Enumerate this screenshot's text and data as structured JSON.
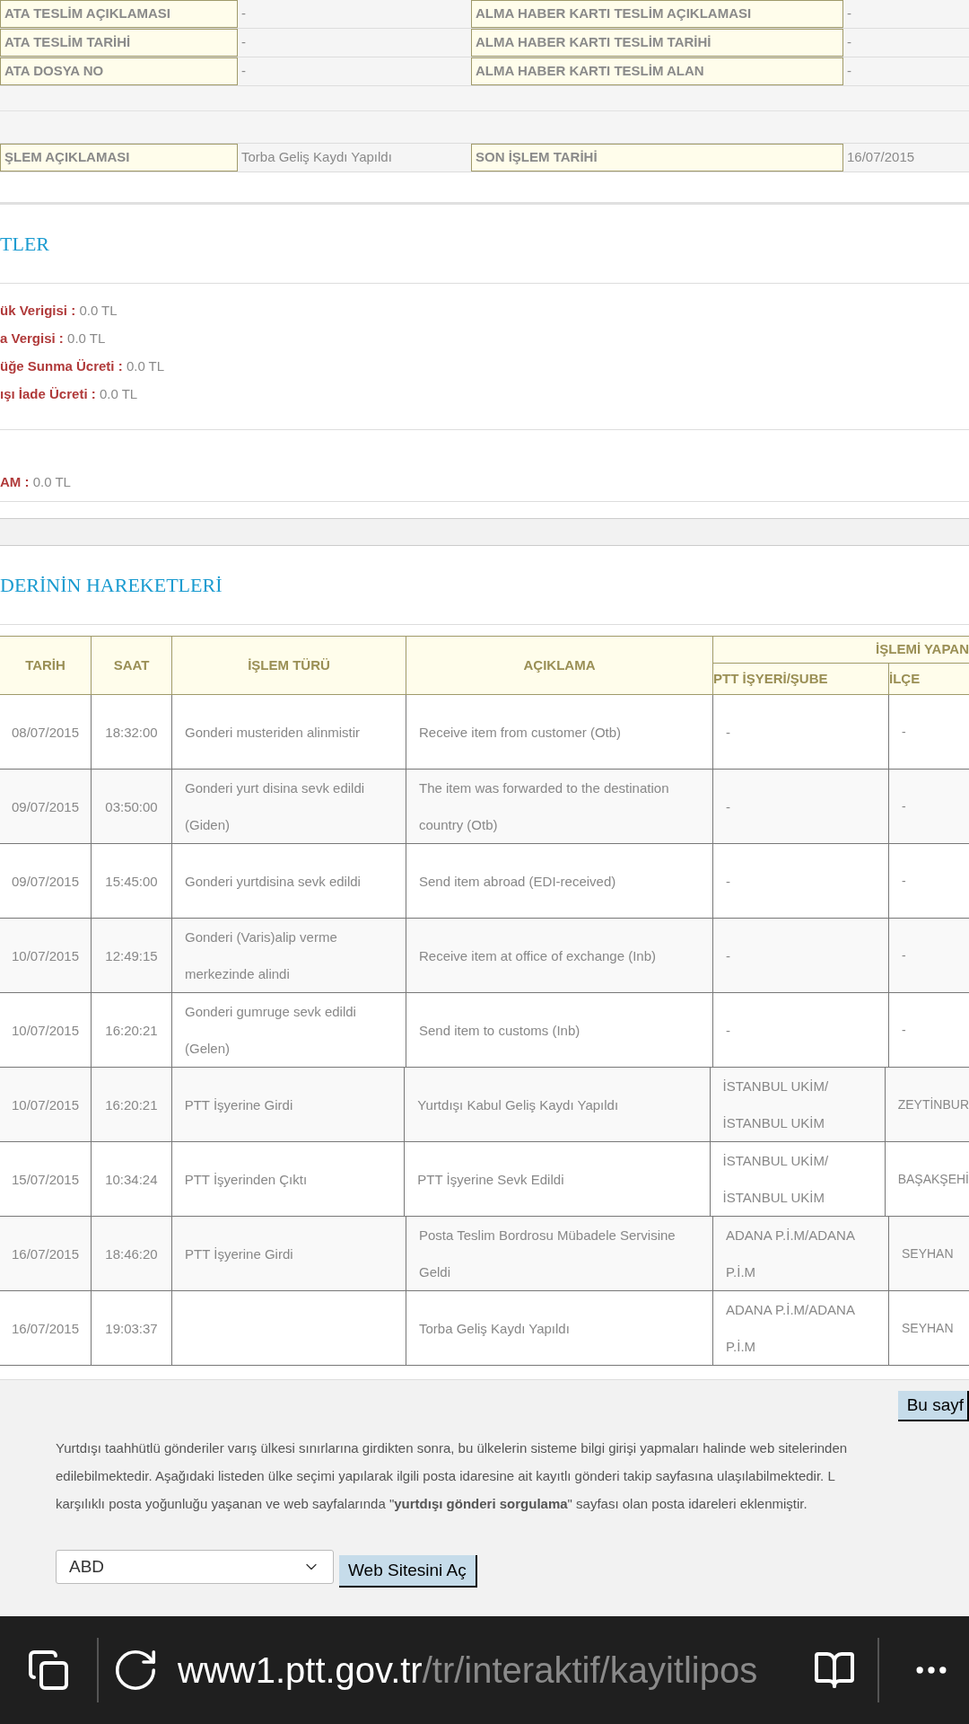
{
  "info_rows": [
    {
      "label_1": "ATA TESLİM AÇIKLAMASI",
      "value_1": "-",
      "label_2": "ALMA HABER KARTI TESLİM AÇIKLAMASI",
      "value_2": "-"
    },
    {
      "label_1": "ATA TESLİM TARİHİ",
      "value_1": "-",
      "label_2": "ALMA HABER KARTI TESLİM TARİHİ",
      "value_2": "-"
    },
    {
      "label_1": "ATA DOSYA NO",
      "value_1": "-",
      "label_2": "ALMA HABER KARTI TESLİM ALAN",
      "value_2": "-"
    }
  ],
  "last_row": {
    "label_1": "ŞLEM AÇIKLAMASI",
    "value_1": "Torba Geliş Kaydı Yapıldı",
    "label_2": "SON İŞLEM TARİHİ",
    "value_2": "16/07/2015"
  },
  "fees_title": "TLER",
  "fees": [
    {
      "label": "ük Verigisi :",
      "value": "0.0 TL"
    },
    {
      "label": "a Vergisi :",
      "value": "0.0 TL"
    },
    {
      "label": "üğe Sunma Ücreti :",
      "value": "0.0 TL"
    },
    {
      "label": "ışı İade Ücreti :",
      "value": "0.0 TL"
    }
  ],
  "total": {
    "label": "AM :",
    "value": "0.0 TL"
  },
  "movements_title": "DERİNİN HAREKETLERİ",
  "table": {
    "columns": [
      "TARİH",
      "SAAT",
      "İŞLEM TÜRÜ",
      "AÇIKLAMA"
    ],
    "group_header": "İŞLEMİ YAPAN",
    "sub_columns": [
      "PTT İŞYERİ/ŞUBE",
      "İLÇE"
    ],
    "rows": [
      {
        "date": "08/07/2015",
        "time": "18:32:00",
        "type": "Gonderi musteriden alinmistir",
        "description": "Receive item from customer (Otb)",
        "office": "-",
        "district": "-"
      },
      {
        "date": "09/07/2015",
        "time": "03:50:00",
        "type": "Gonderi yurt disina sevk edildi (Giden)",
        "description": "The item was forwarded to the destination country (Otb)",
        "office": "-",
        "district": "-"
      },
      {
        "date": "09/07/2015",
        "time": "15:45:00",
        "type": "Gonderi yurtdisina sevk edildi",
        "description": "Send item abroad (EDI-received)",
        "office": "-",
        "district": "-"
      },
      {
        "date": "10/07/2015",
        "time": "12:49:15",
        "type": "Gonderi (Varis)alip verme merkezinde alindi",
        "description": "Receive item at office of exchange (Inb)",
        "office": "-",
        "district": "-"
      },
      {
        "date": "10/07/2015",
        "time": "16:20:21",
        "type": "Gonderi gumruge sevk edildi (Gelen)",
        "description": "Send item to customs (Inb)",
        "office": "-",
        "district": "-"
      },
      {
        "date": "10/07/2015",
        "time": "16:20:21",
        "type": "PTT İşyerine Girdi",
        "description": "Yurtdışı Kabul Geliş Kaydı Yapıldı",
        "office": "İSTANBUL UKİM/İSTANBUL UKİM",
        "district": "ZEYTİNBUR"
      },
      {
        "date": "15/07/2015",
        "time": "10:34:24",
        "type": "PTT İşyerinden Çıktı",
        "description": "PTT İşyerine Sevk Edildi",
        "office": "İSTANBUL UKİM/İSTANBUL UKİM",
        "district": "BAŞAKŞEHİ"
      },
      {
        "date": "16/07/2015",
        "time": "18:46:20",
        "type": "PTT İşyerine Girdi",
        "description": "Posta Teslim Bordrosu Mübadele Servisine Geldi",
        "office": "ADANA P.İ.M/ADANA P.İ.M",
        "district": "SEYHAN"
      },
      {
        "date": "16/07/2015",
        "time": "19:03:37",
        "type": "",
        "description": "Torba Geliş Kaydı Yapıldı",
        "office": "ADANA P.İ.M/ADANA P.İ.M",
        "district": "SEYHAN"
      }
    ]
  },
  "print_button": "Bu sayf",
  "notice_lines": [
    "Yurtdışı taahhütlü gönderiler varış ülkesi sınırlarına girdikten sonra, bu ülkelerin sisteme bilgi girişi yapmaları halinde web sitelerinden",
    "edilebilmektedir. Aşağıdaki listeden ülke seçimi yapılarak ilgili posta idaresine ait  kayıtlı gönderi takip  sayfasına ulaşılabilmektedir. L",
    "karşılıklı posta yoğunluğu yaşanan ve web sayfalarında \"**yurtdışı gönderi sorgulama**\" sayfası olan posta idareleri eklenmiştir."
  ],
  "country_select": {
    "value": "ABD"
  },
  "open_site_button": "Web Sitesini Aç",
  "address_bar": {
    "domain": "www1.ptt.gov.tr",
    "path": "/tr/interaktif/kayitlipos"
  }
}
